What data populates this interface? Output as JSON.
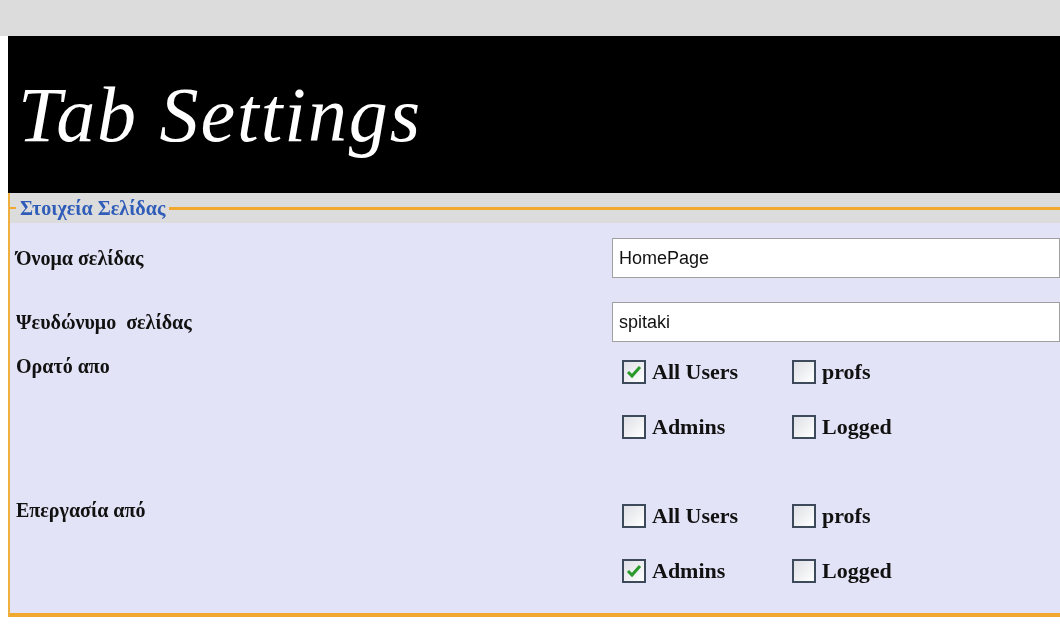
{
  "banner": {
    "title": "Tab Settings"
  },
  "section": {
    "legend": "Στοιχεία Σελίδας"
  },
  "fields": [
    {
      "label": "Όνομα σελίδας",
      "value": "HomePage"
    },
    {
      "label": "Ψευδώνυμο  σελίδας",
      "value": "spitaki"
    }
  ],
  "groups": [
    {
      "label": "Ορατό απο",
      "options": [
        {
          "label": "All Users",
          "checked": true
        },
        {
          "label": "profs",
          "checked": false
        },
        {
          "label": "Admins",
          "checked": false
        },
        {
          "label": "Logged",
          "checked": false
        }
      ]
    },
    {
      "label": "Επεργασία από",
      "options": [
        {
          "label": "All Users",
          "checked": false
        },
        {
          "label": "profs",
          "checked": false
        },
        {
          "label": "Admins",
          "checked": true
        },
        {
          "label": "Logged",
          "checked": false
        }
      ]
    }
  ]
}
